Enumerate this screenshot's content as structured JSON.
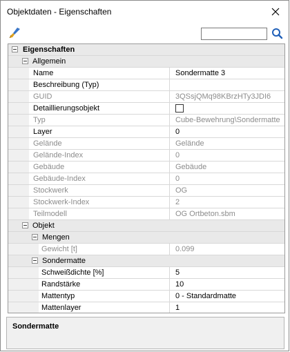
{
  "window": {
    "title": "Objektdaten - Eigenschaften"
  },
  "toolbar": {
    "search": {
      "value": "",
      "placeholder": ""
    }
  },
  "grid": {
    "categories": {
      "eigenschaften": "Eigenschaften",
      "allgemein": "Allgemein",
      "objekt": "Objekt",
      "mengen": "Mengen",
      "sondermatte": "Sondermatte"
    },
    "allgemein": [
      {
        "label": "Name",
        "value": "Sondermatte 3"
      },
      {
        "label": "Beschreibung (Typ)",
        "value": ""
      },
      {
        "label": "GUID",
        "value": "3QSsjQMq98KBrzHTy3JDI6"
      },
      {
        "label": "Detaillierungsobjekt",
        "value": "",
        "checked": false
      },
      {
        "label": "Typ",
        "value": "Cube-Bewehrung\\Sondermatte"
      },
      {
        "label": "Layer",
        "value": "0"
      },
      {
        "label": "Gelände",
        "value": "Gelände"
      },
      {
        "label": "Gelände-Index",
        "value": "0"
      },
      {
        "label": "Gebäude",
        "value": "Gebäude"
      },
      {
        "label": "Gebäude-Index",
        "value": "0"
      },
      {
        "label": "Stockwerk",
        "value": "OG"
      },
      {
        "label": "Stockwerk-Index",
        "value": "2"
      },
      {
        "label": "Teilmodell",
        "value": "OG Ortbeton.sbm"
      }
    ],
    "mengen": [
      {
        "label": "Gewicht [t]",
        "value": "0.099"
      }
    ],
    "sondermatte": [
      {
        "label": "Schweißdichte [%]",
        "value": "5"
      },
      {
        "label": "Randstärke",
        "value": "10"
      },
      {
        "label": "Mattentyp",
        "value": "0 - Standardmatte"
      },
      {
        "label": "Mattenlayer",
        "value": "1"
      }
    ]
  },
  "description": {
    "title": "Sondermatte"
  },
  "colors": {
    "category_bg": "#e9e9e9",
    "gutter_bg": "#f0f0f0",
    "disabled_text": "#8c8c8c",
    "search_icon": "#1f5fb8",
    "brush_handle": "#3a76c8",
    "brush_tip": "#e0a21e"
  }
}
